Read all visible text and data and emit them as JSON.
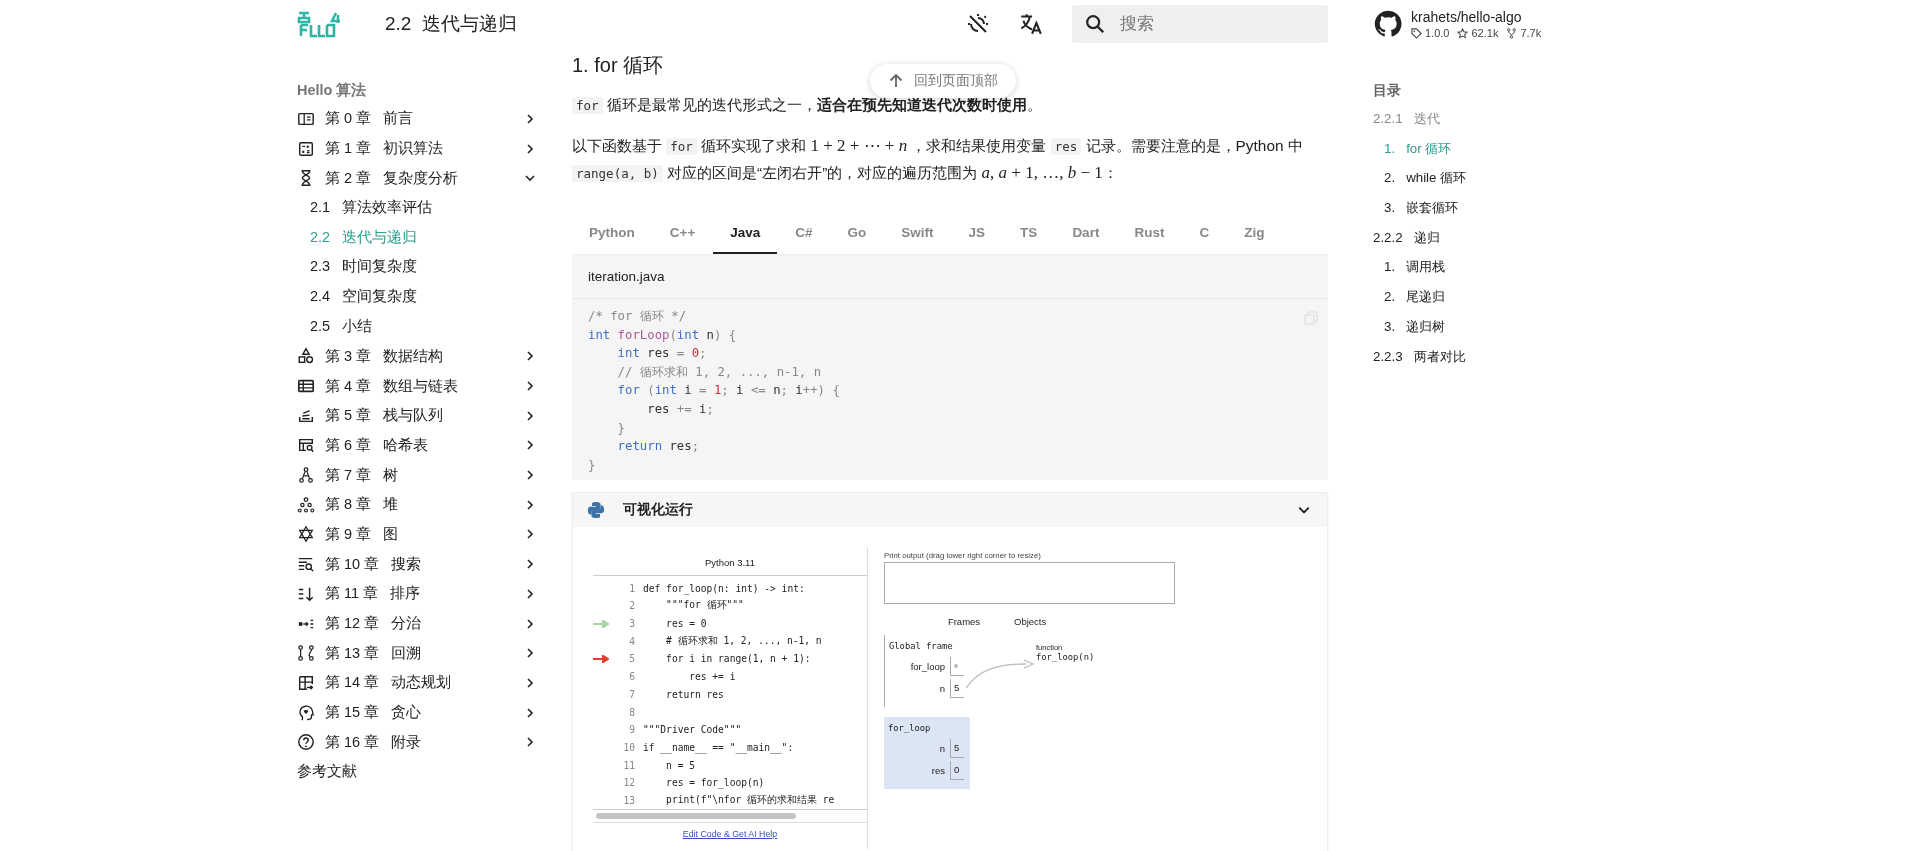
{
  "header": {
    "title": "2.2  迭代与递归",
    "search": {
      "placeholder": "搜索"
    },
    "repo": {
      "name": "krahets/hello-algo",
      "version": "1.0.0",
      "stars": "62.1k",
      "forks": "7.7k"
    }
  },
  "back_to_top": "回到页面顶部",
  "sidebar": {
    "title": "Hello 算法",
    "items": [
      {
        "label": "第 0 章   前言",
        "expanded": false
      },
      {
        "label": "第 1 章   初识算法",
        "expanded": false
      },
      {
        "label": "第 2 章   复杂度分析",
        "expanded": true,
        "children": [
          {
            "label": "2.1   算法效率评估",
            "selected": false
          },
          {
            "label": "2.2   迭代与递归",
            "selected": true
          },
          {
            "label": "2.3   时间复杂度",
            "selected": false
          },
          {
            "label": "2.4   空间复杂度",
            "selected": false
          },
          {
            "label": "2.5   小结",
            "selected": false
          }
        ]
      },
      {
        "label": "第 3 章   数据结构",
        "expanded": false
      },
      {
        "label": "第 4 章   数组与链表",
        "expanded": false
      },
      {
        "label": "第 5 章   栈与队列",
        "expanded": false
      },
      {
        "label": "第 6 章   哈希表",
        "expanded": false
      },
      {
        "label": "第 7 章   树",
        "expanded": false
      },
      {
        "label": "第 8 章   堆",
        "expanded": false
      },
      {
        "label": "第 9 章   图",
        "expanded": false
      },
      {
        "label": "第 10 章   搜索",
        "expanded": false
      },
      {
        "label": "第 11 章   排序",
        "expanded": false
      },
      {
        "label": "第 12 章   分治",
        "expanded": false
      },
      {
        "label": "第 13 章   回溯",
        "expanded": false
      },
      {
        "label": "第 14 章   动态规划",
        "expanded": false
      },
      {
        "label": "第 15 章   贪心",
        "expanded": false
      },
      {
        "label": "第 16 章   附录",
        "expanded": false
      }
    ],
    "footer_link": "参考文献"
  },
  "content": {
    "heading": "1.  for 循环",
    "paragraphs": [
      [
        {
          "kind": "code",
          "text": "for"
        },
        {
          "kind": "text",
          "text": " 循环是最常见的迭代形式之一，**适合在预先知道迭代次数时使用**。"
        }
      ],
      [
        {
          "kind": "text",
          "text": "以下函数基于 "
        },
        {
          "kind": "code",
          "text": "for"
        },
        {
          "kind": "text",
          "text": " 循环实现了求和 "
        },
        {
          "kind": "math",
          "text": "1 + 2 + ⋯ + *n*"
        },
        {
          "kind": "text",
          "text": " ，求和结果使用变量 "
        },
        {
          "kind": "code",
          "text": "res"
        },
        {
          "kind": "text",
          "text": " 记录。需要注意的是，Python 中 "
        },
        {
          "kind": "code",
          "text": "range(a, b)"
        },
        {
          "kind": "text",
          "text": " 对应的区间是“左闭右开”的，对应的遍历范围为 "
        },
        {
          "kind": "math",
          "text": "*a*, *a* + 1, …, *b* − 1"
        },
        {
          "kind": "text",
          "text": "："
        }
      ]
    ],
    "tabs": [
      {
        "label": "Python",
        "selected": false
      },
      {
        "label": "C++",
        "selected": false
      },
      {
        "label": "Java",
        "selected": true
      },
      {
        "label": "C#",
        "selected": false
      },
      {
        "label": "Go",
        "selected": false
      },
      {
        "label": "Swift",
        "selected": false
      },
      {
        "label": "JS",
        "selected": false
      },
      {
        "label": "TS",
        "selected": false
      },
      {
        "label": "Dart",
        "selected": false
      },
      {
        "label": "Rust",
        "selected": false
      },
      {
        "label": "C",
        "selected": false
      },
      {
        "label": "Zig",
        "selected": false
      }
    ],
    "code": {
      "filename": "iteration.java",
      "lines": [
        [
          {
            "kind": "comment",
            "text": "/* for 循环 */"
          }
        ],
        [
          {
            "kind": "keyword",
            "text": "int"
          },
          {
            "kind": "function",
            "text": " forLoop"
          },
          {
            "kind": "punct",
            "text": "("
          },
          {
            "kind": "keyword",
            "text": "int"
          },
          {
            "kind": "plain",
            "text": " n"
          },
          {
            "kind": "punct",
            "text": ") {"
          }
        ],
        [
          {
            "kind": "keyword",
            "text": "    int"
          },
          {
            "kind": "plain",
            "text": " res "
          },
          {
            "kind": "punct",
            "text": "="
          },
          {
            "kind": "number",
            "text": " 0"
          },
          {
            "kind": "punct",
            "text": ";"
          }
        ],
        [
          {
            "kind": "comment",
            "text": "    // 循环求和 1, 2, ..., n-1, n"
          }
        ],
        [
          {
            "kind": "keyword",
            "text": "    for"
          },
          {
            "kind": "punct",
            "text": " ("
          },
          {
            "kind": "keyword",
            "text": "int"
          },
          {
            "kind": "plain",
            "text": " i "
          },
          {
            "kind": "punct",
            "text": "="
          },
          {
            "kind": "number",
            "text": " 1"
          },
          {
            "kind": "punct",
            "text": ";"
          },
          {
            "kind": "plain",
            "text": " i "
          },
          {
            "kind": "punct",
            "text": "<="
          },
          {
            "kind": "plain",
            "text": " n"
          },
          {
            "kind": "punct",
            "text": ";"
          },
          {
            "kind": "plain",
            "text": " i"
          },
          {
            "kind": "punct",
            "text": "++) {"
          }
        ],
        [
          {
            "kind": "plain",
            "text": "        res "
          },
          {
            "kind": "punct",
            "text": "+="
          },
          {
            "kind": "plain",
            "text": " i"
          },
          {
            "kind": "punct",
            "text": ";"
          }
        ],
        [
          {
            "kind": "punct",
            "text": "    }"
          }
        ],
        [
          {
            "kind": "keyword",
            "text": "    return"
          },
          {
            "kind": "plain",
            "text": " res"
          },
          {
            "kind": "punct",
            "text": ";"
          }
        ],
        [
          {
            "kind": "punct",
            "text": "}"
          }
        ]
      ]
    },
    "visualizer": {
      "title": "可视化运行",
      "expanded": true,
      "language": "Python 3.11",
      "lines": [
        {
          "number": "1",
          "text": "def for_loop(n: int) -> int:",
          "kind": "line"
        },
        {
          "number": "2",
          "text": "    \"\"\"for 循环\"\"\"",
          "kind": "line"
        },
        {
          "number": "3",
          "text": "    res = 0",
          "kind": "previous_line"
        },
        {
          "number": "4",
          "text": "    # 循环求和 1, 2, ..., n-1, n",
          "kind": "line"
        },
        {
          "number": "5",
          "text": "    for i in range(1, n + 1):",
          "kind": "next_line"
        },
        {
          "number": "6",
          "text": "        res += i",
          "kind": "line"
        },
        {
          "number": "7",
          "text": "    return res",
          "kind": "line"
        },
        {
          "number": "8",
          "kind": "line"
        },
        {
          "number": "9",
          "text": "\"\"\"Driver Code\"\"\"",
          "kind": "line"
        },
        {
          "number": "10",
          "text": "if __name__ == \"__main__\":",
          "kind": "line"
        },
        {
          "number": "11",
          "text": "    n = 5",
          "kind": "line"
        },
        {
          "number": "12",
          "text": "    res = for_loop(n)",
          "kind": "line"
        },
        {
          "number": "13",
          "text": "    print(f\"\\nfor 循环的求和结果 re",
          "kind": "line"
        }
      ],
      "edit_link": "Edit Code & Get AI Help",
      "print_output_label": "Print output (drag lower right corner to resize)",
      "frames_label": "Frames",
      "objects_label": "Objects",
      "frames": [
        {
          "title": "Global frame",
          "highlighted": false,
          "vars": [
            {
              "name": "for_loop",
              "kind": "pointer"
            },
            {
              "name": "n",
              "kind": "value",
              "value": "5"
            }
          ]
        },
        {
          "title": "for_loop",
          "highlighted": true,
          "vars": [
            {
              "name": "n",
              "kind": "value",
              "value": "5"
            },
            {
              "name": "res",
              "kind": "value",
              "value": "0"
            }
          ]
        }
      ],
      "object": {
        "type_label": "function",
        "value": "for_loop(n)"
      }
    }
  },
  "toc": {
    "title": "目录",
    "items": [
      {
        "label": "2.2.1   迭代",
        "passed": true,
        "selected": false,
        "children": [
          {
            "label": "1.   for 循环",
            "passed": false,
            "selected": true
          },
          {
            "label": "2.   while 循环",
            "passed": false,
            "selected": false
          },
          {
            "label": "3.   嵌套循环",
            "passed": false,
            "selected": false
          }
        ]
      },
      {
        "label": "2.2.2   递归",
        "passed": false,
        "selected": false,
        "children": [
          {
            "label": "1.   调用栈",
            "passed": false,
            "selected": false
          },
          {
            "label": "2.   尾递归",
            "passed": false,
            "selected": false
          },
          {
            "label": "3.   递归树",
            "passed": false,
            "selected": false
          }
        ]
      },
      {
        "label": "2.2.3   两者对比",
        "passed": false,
        "selected": false
      }
    ]
  }
}
